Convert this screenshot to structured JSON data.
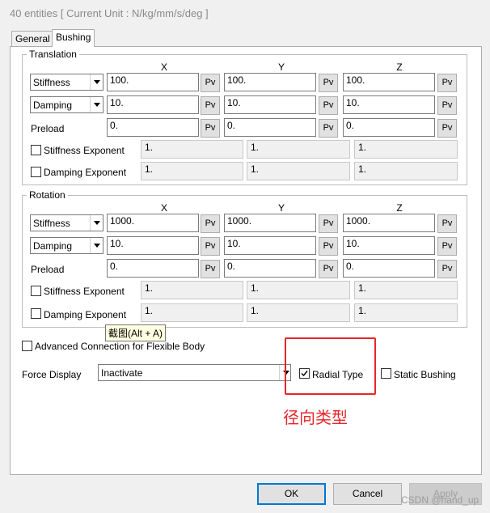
{
  "window": {
    "title": "40 entities [ Current Unit : N/kg/mm/s/deg ]"
  },
  "tabs": [
    {
      "label": "General"
    },
    {
      "label": "Bushing"
    }
  ],
  "columns": {
    "x": "X",
    "y": "Y",
    "z": "Z"
  },
  "pv_label": "Pv",
  "translation": {
    "legend": "Translation",
    "stiffness": {
      "type": "Stiffness",
      "x": "100.",
      "y": "100.",
      "z": "100."
    },
    "damping": {
      "type": "Damping",
      "x": "10.",
      "y": "10.",
      "z": "10."
    },
    "preload": {
      "label": "Preload",
      "x": "0.",
      "y": "0.",
      "z": "0."
    },
    "stiffness_exponent": {
      "label": "Stiffness Exponent",
      "x": "1.",
      "y": "1.",
      "z": "1."
    },
    "damping_exponent": {
      "label": "Damping Exponent",
      "x": "1.",
      "y": "1.",
      "z": "1."
    }
  },
  "rotation": {
    "legend": "Rotation",
    "stiffness": {
      "type": "Stiffness",
      "x": "1000.",
      "y": "1000.",
      "z": "1000."
    },
    "damping": {
      "type": "Damping",
      "x": "10.",
      "y": "10.",
      "z": "10."
    },
    "preload": {
      "label": "Preload",
      "x": "0.",
      "y": "0.",
      "z": "0."
    },
    "stiffness_exponent": {
      "label": "Stiffness Exponent",
      "x": "1.",
      "y": "1.",
      "z": "1."
    },
    "damping_exponent": {
      "label": "Damping Exponent",
      "x": "1.",
      "y": "1.",
      "z": "1."
    }
  },
  "tooltip": "截图(Alt + A)",
  "advanced_connection": {
    "label": "Advanced Connection for Flexible Body",
    "checked": false
  },
  "force_display": {
    "label": "Force Display",
    "value": "Inactivate"
  },
  "radial_type": {
    "label": "Radial Type",
    "checked": true
  },
  "static_bushing": {
    "label": "Static Bushing",
    "checked": false
  },
  "annotation": "径向类型",
  "buttons": {
    "ok": "OK",
    "cancel": "Cancel",
    "apply": "Apply"
  },
  "watermark": "CSDN @hand_up"
}
